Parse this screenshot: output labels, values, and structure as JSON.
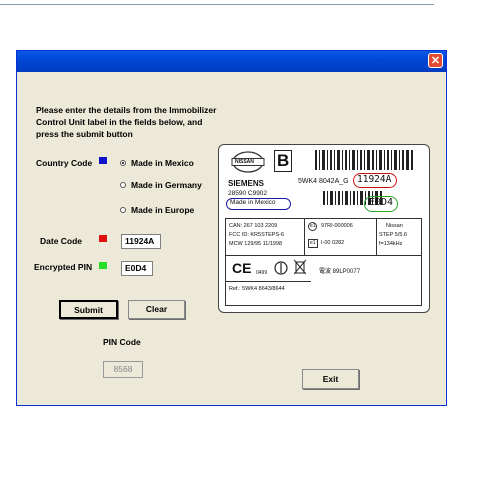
{
  "window": {
    "close_glyph": "✕"
  },
  "form": {
    "instructions": "Please enter the details from the Immobilizer Control Unit label  in the fields below, and press the submit button",
    "country_label": "Country Code",
    "country_color": "#1111cc",
    "country_options": [
      "Made in Mexico",
      "Made in Germany",
      "Made in Europe"
    ],
    "country_selected": "Made in Mexico",
    "date_label": "Date Code",
    "date_color": "#e01010",
    "date_value": "11924A",
    "pin_label": "Encrypted PIN",
    "pin_color": "#22dd22",
    "pin_value": "E0D4",
    "submit_label": "Submit",
    "clear_label": "Clear",
    "pin_code_label": "PIN Code",
    "pin_code_value": "8568",
    "exit_label": "Exit"
  },
  "label_image": {
    "brand": "NISSAN",
    "letter": "B",
    "maker": "SIEMENS",
    "part_number": "28590 C9902",
    "origin": "Made in Mexico",
    "serial_prefix": "5WK4 8042A_G",
    "date_code": "11924A",
    "pin_code": "E0D4",
    "can": "CAN: 267 103 2209",
    "fcc": "FCC ID: KR5STEPS-6",
    "mcw": "MCW 129/95 11/1998",
    "e1_top": "97RI-000006",
    "e1_bottom": "I-00 0282",
    "nissan_step": "Nissan",
    "step": "STEP 5/5.6",
    "freq": "f=134kHz",
    "ce": "CE",
    "ce_num": "0499",
    "jp_code": "電波  89LP0077",
    "ref": "Ref.: 5WK4 8643/8644",
    "e1_mark": "e1"
  },
  "icons": {
    "close": "close-icon",
    "nissan_logo": "nissan-logo-icon",
    "barcode": "barcode-icon",
    "ce_mark": "ce-mark-icon",
    "recycle": "recycle-bin-icon"
  },
  "colors": {
    "title_bar": "#0a5ae6",
    "window_bg": "#ece9d8",
    "origin_ring": "#1a1aa0",
    "date_ring": "#cc1111",
    "pin_ring": "#2aa52a"
  }
}
